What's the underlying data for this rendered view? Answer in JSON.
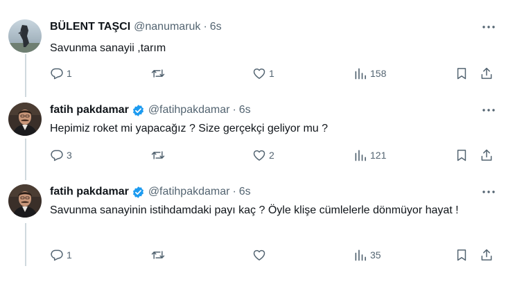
{
  "tweets": [
    {
      "name": "BÜLENT TAŞCI",
      "handle": "@nanumaruk",
      "dot": "·",
      "time": "6s",
      "verified": false,
      "text": "Savunma sanayii ,tarım",
      "replies": "1",
      "retweets": "",
      "likes": "1",
      "views": "158"
    },
    {
      "name": "fatih pakdamar",
      "handle": "@fatihpakdamar",
      "dot": "·",
      "time": "6s",
      "verified": true,
      "text": "Hepimiz roket mi yapacağız ? Size gerçekçi geliyor mu ?",
      "replies": "3",
      "retweets": "",
      "likes": "2",
      "views": "121"
    },
    {
      "name": "fatih pakdamar",
      "handle": "@fatihpakdamar",
      "dot": "·",
      "time": "6s",
      "verified": true,
      "text": "Savunma sanayinin istihdamdaki payı kaç ? Öyle klişe cümlelerle dönmüyor hayat !",
      "replies": "1",
      "retweets": "",
      "likes": "",
      "views": "35"
    }
  ],
  "icons": {
    "reply": "reply-icon",
    "retweet": "retweet-icon",
    "like": "heart-icon",
    "views": "views-icon",
    "bookmark": "bookmark-icon",
    "share": "share-icon",
    "more": "more-icon",
    "verified": "verified-badge-icon"
  },
  "colors": {
    "text_primary": "#0f1419",
    "text_secondary": "#536471",
    "verified_blue": "#1d9bf0",
    "thread_line": "#cfd9de"
  }
}
